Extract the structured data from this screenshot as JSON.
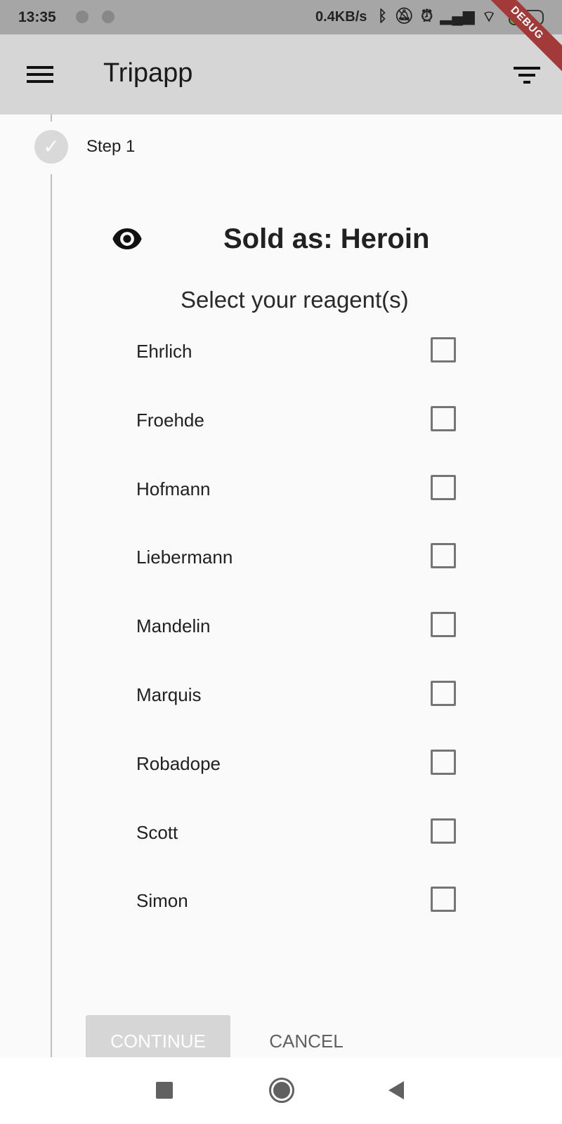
{
  "status_bar": {
    "time": "13:35",
    "net_speed": "0.4KB/s",
    "battery": "52",
    "icons": [
      "bluetooth-icon",
      "bell-off-icon",
      "alarm-icon",
      "signal-icon",
      "wifi-icon",
      "battery-icon"
    ]
  },
  "app_bar": {
    "title": "Tripapp",
    "debug_banner": "DEBUG"
  },
  "stepper": {
    "step_label": "Step 1"
  },
  "content": {
    "title": "Sold as: Heroin",
    "subtitle": "Select your reagent(s)",
    "reagents": [
      {
        "label": "Ehrlich",
        "checked": false
      },
      {
        "label": "Froehde",
        "checked": false
      },
      {
        "label": "Hofmann",
        "checked": false
      },
      {
        "label": "Liebermann",
        "checked": false
      },
      {
        "label": "Mandelin",
        "checked": false
      },
      {
        "label": "Marquis",
        "checked": false
      },
      {
        "label": "Robadope",
        "checked": false
      },
      {
        "label": "Scott",
        "checked": false
      },
      {
        "label": "Simon",
        "checked": false
      }
    ]
  },
  "actions": {
    "continue": "CONTINUE",
    "cancel": "CANCEL"
  }
}
